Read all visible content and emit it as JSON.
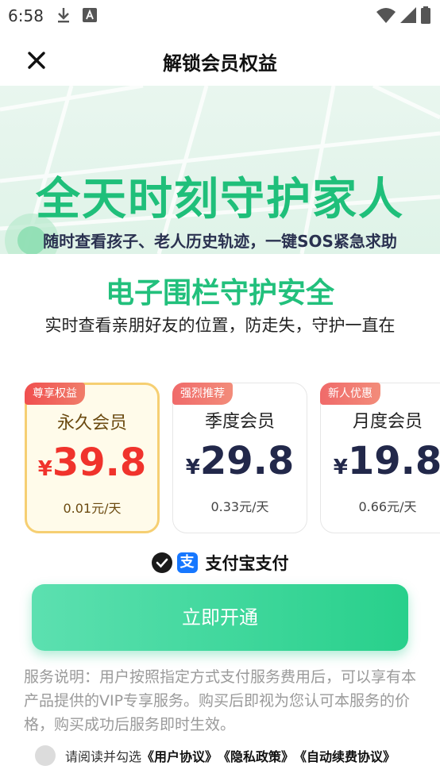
{
  "status_bar": {
    "time": "6:58",
    "left_icons": [
      "download-icon",
      "a-notification-icon"
    ],
    "right_icons": [
      "wifi-icon",
      "signal-icon",
      "battery-icon"
    ]
  },
  "nav": {
    "title": "解锁会员权益",
    "close_icon": "close-icon"
  },
  "banner": {
    "title": "全天时刻守护家人",
    "subtitle": "随时查看孩子、老人历史轨迹，一键SOS紧急求助"
  },
  "feature": {
    "title": "电子围栏守护安全",
    "description": "实时查看亲朋好友的位置，防走失，守护一直在"
  },
  "plans": [
    {
      "badge": "尊享权益",
      "name": "永久会员",
      "currency": "¥",
      "price": "39.8",
      "daily": "0.01元/天",
      "selected": true
    },
    {
      "badge": "强烈推荐",
      "name": "季度会员",
      "currency": "¥",
      "price": "29.8",
      "daily": "0.33元/天",
      "selected": false
    },
    {
      "badge": "新人优惠",
      "name": "月度会员",
      "currency": "¥",
      "price": "19.8",
      "daily": "0.66元/天",
      "selected": false
    }
  ],
  "payment": {
    "method_label": "支付宝支付",
    "method_icon": "alipay-icon",
    "checked": true
  },
  "cta": {
    "label": "立即开通"
  },
  "service_note": "服务说明：用户按照指定方式支付服务费用后，可以享有本产品提供的VIP专享服务。购买后即视为您认可本服务的价格，购买成功后服务即时生效。",
  "agreement": {
    "prefix": "请阅读并勾选",
    "links": [
      "《用户协议》",
      "《隐私政策》",
      "《自动续费协议》"
    ],
    "checked": false
  },
  "colors": {
    "accent_green": "#22c07c",
    "price_red": "#f0332c",
    "price_navy": "#22284a",
    "selected_border": "#f6cf72",
    "badge_red": "#f06a6a",
    "alipay_blue": "#1677ff"
  }
}
